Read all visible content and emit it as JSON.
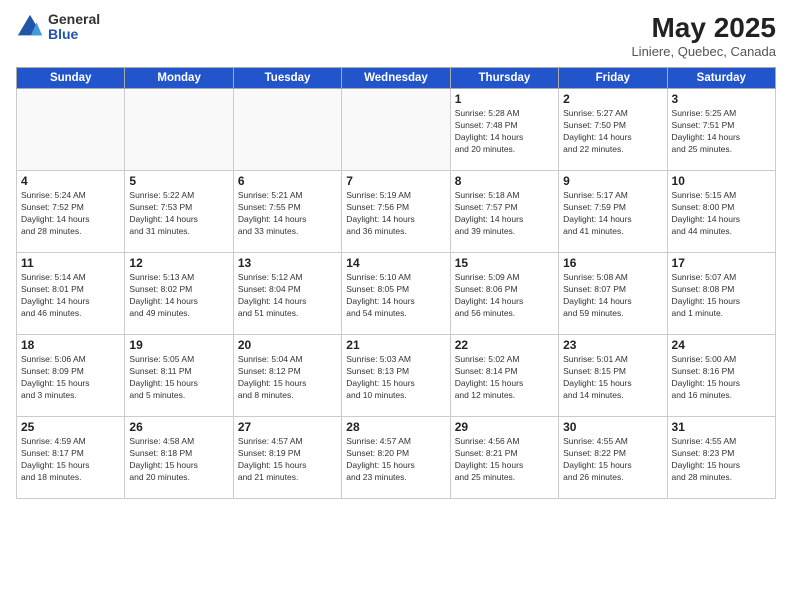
{
  "header": {
    "logo_general": "General",
    "logo_blue": "Blue",
    "title": "May 2025",
    "location": "Liniere, Quebec, Canada"
  },
  "days_of_week": [
    "Sunday",
    "Monday",
    "Tuesday",
    "Wednesday",
    "Thursday",
    "Friday",
    "Saturday"
  ],
  "weeks": [
    [
      {
        "day": "",
        "info": ""
      },
      {
        "day": "",
        "info": ""
      },
      {
        "day": "",
        "info": ""
      },
      {
        "day": "",
        "info": ""
      },
      {
        "day": "1",
        "info": "Sunrise: 5:28 AM\nSunset: 7:48 PM\nDaylight: 14 hours\nand 20 minutes."
      },
      {
        "day": "2",
        "info": "Sunrise: 5:27 AM\nSunset: 7:50 PM\nDaylight: 14 hours\nand 22 minutes."
      },
      {
        "day": "3",
        "info": "Sunrise: 5:25 AM\nSunset: 7:51 PM\nDaylight: 14 hours\nand 25 minutes."
      }
    ],
    [
      {
        "day": "4",
        "info": "Sunrise: 5:24 AM\nSunset: 7:52 PM\nDaylight: 14 hours\nand 28 minutes."
      },
      {
        "day": "5",
        "info": "Sunrise: 5:22 AM\nSunset: 7:53 PM\nDaylight: 14 hours\nand 31 minutes."
      },
      {
        "day": "6",
        "info": "Sunrise: 5:21 AM\nSunset: 7:55 PM\nDaylight: 14 hours\nand 33 minutes."
      },
      {
        "day": "7",
        "info": "Sunrise: 5:19 AM\nSunset: 7:56 PM\nDaylight: 14 hours\nand 36 minutes."
      },
      {
        "day": "8",
        "info": "Sunrise: 5:18 AM\nSunset: 7:57 PM\nDaylight: 14 hours\nand 39 minutes."
      },
      {
        "day": "9",
        "info": "Sunrise: 5:17 AM\nSunset: 7:59 PM\nDaylight: 14 hours\nand 41 minutes."
      },
      {
        "day": "10",
        "info": "Sunrise: 5:15 AM\nSunset: 8:00 PM\nDaylight: 14 hours\nand 44 minutes."
      }
    ],
    [
      {
        "day": "11",
        "info": "Sunrise: 5:14 AM\nSunset: 8:01 PM\nDaylight: 14 hours\nand 46 minutes."
      },
      {
        "day": "12",
        "info": "Sunrise: 5:13 AM\nSunset: 8:02 PM\nDaylight: 14 hours\nand 49 minutes."
      },
      {
        "day": "13",
        "info": "Sunrise: 5:12 AM\nSunset: 8:04 PM\nDaylight: 14 hours\nand 51 minutes."
      },
      {
        "day": "14",
        "info": "Sunrise: 5:10 AM\nSunset: 8:05 PM\nDaylight: 14 hours\nand 54 minutes."
      },
      {
        "day": "15",
        "info": "Sunrise: 5:09 AM\nSunset: 8:06 PM\nDaylight: 14 hours\nand 56 minutes."
      },
      {
        "day": "16",
        "info": "Sunrise: 5:08 AM\nSunset: 8:07 PM\nDaylight: 14 hours\nand 59 minutes."
      },
      {
        "day": "17",
        "info": "Sunrise: 5:07 AM\nSunset: 8:08 PM\nDaylight: 15 hours\nand 1 minute."
      }
    ],
    [
      {
        "day": "18",
        "info": "Sunrise: 5:06 AM\nSunset: 8:09 PM\nDaylight: 15 hours\nand 3 minutes."
      },
      {
        "day": "19",
        "info": "Sunrise: 5:05 AM\nSunset: 8:11 PM\nDaylight: 15 hours\nand 5 minutes."
      },
      {
        "day": "20",
        "info": "Sunrise: 5:04 AM\nSunset: 8:12 PM\nDaylight: 15 hours\nand 8 minutes."
      },
      {
        "day": "21",
        "info": "Sunrise: 5:03 AM\nSunset: 8:13 PM\nDaylight: 15 hours\nand 10 minutes."
      },
      {
        "day": "22",
        "info": "Sunrise: 5:02 AM\nSunset: 8:14 PM\nDaylight: 15 hours\nand 12 minutes."
      },
      {
        "day": "23",
        "info": "Sunrise: 5:01 AM\nSunset: 8:15 PM\nDaylight: 15 hours\nand 14 minutes."
      },
      {
        "day": "24",
        "info": "Sunrise: 5:00 AM\nSunset: 8:16 PM\nDaylight: 15 hours\nand 16 minutes."
      }
    ],
    [
      {
        "day": "25",
        "info": "Sunrise: 4:59 AM\nSunset: 8:17 PM\nDaylight: 15 hours\nand 18 minutes."
      },
      {
        "day": "26",
        "info": "Sunrise: 4:58 AM\nSunset: 8:18 PM\nDaylight: 15 hours\nand 20 minutes."
      },
      {
        "day": "27",
        "info": "Sunrise: 4:57 AM\nSunset: 8:19 PM\nDaylight: 15 hours\nand 21 minutes."
      },
      {
        "day": "28",
        "info": "Sunrise: 4:57 AM\nSunset: 8:20 PM\nDaylight: 15 hours\nand 23 minutes."
      },
      {
        "day": "29",
        "info": "Sunrise: 4:56 AM\nSunset: 8:21 PM\nDaylight: 15 hours\nand 25 minutes."
      },
      {
        "day": "30",
        "info": "Sunrise: 4:55 AM\nSunset: 8:22 PM\nDaylight: 15 hours\nand 26 minutes."
      },
      {
        "day": "31",
        "info": "Sunrise: 4:55 AM\nSunset: 8:23 PM\nDaylight: 15 hours\nand 28 minutes."
      }
    ]
  ]
}
